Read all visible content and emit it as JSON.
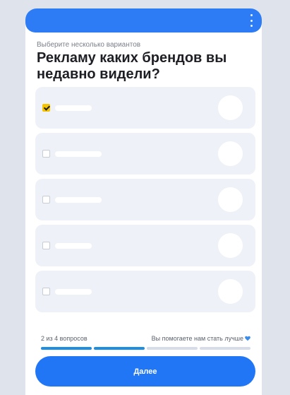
{
  "header": {
    "menu_icon": "kebab-menu-icon",
    "color": "#2d7cf6"
  },
  "survey": {
    "subtitle": "Выберите несколько вариантов",
    "question": "Рекламу каких брендов вы недавно видели?",
    "options": [
      {
        "checked": true
      },
      {
        "checked": false
      },
      {
        "checked": false
      },
      {
        "checked": false
      },
      {
        "checked": false
      }
    ]
  },
  "progress": {
    "text": "2 из 4 вопросов",
    "current": 2,
    "total": 4,
    "message": "Вы помогаете нам стать лучше",
    "message_icon": "blue-heart-icon"
  },
  "actions": {
    "next_label": "Далее",
    "accent": "#2176f5"
  }
}
